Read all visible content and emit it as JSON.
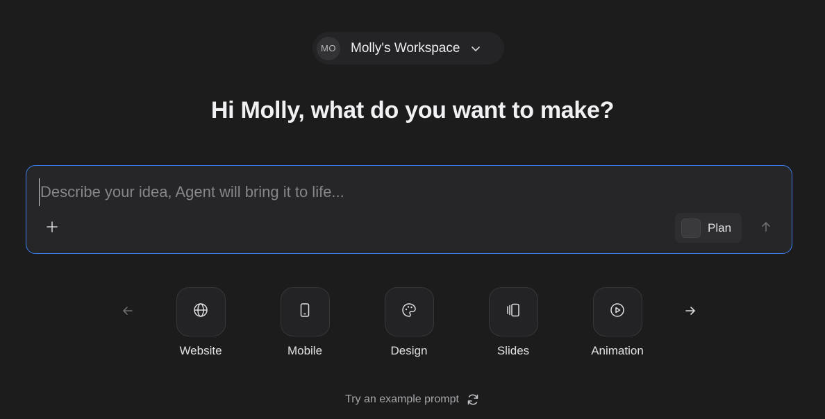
{
  "workspace": {
    "avatar_initials": "MO",
    "name": "Molly's Workspace",
    "chevron_icon": "chevron-down-icon"
  },
  "greeting": "Hi Molly, what do you want to make?",
  "prompt": {
    "placeholder": "Describe your idea, Agent will bring it to life...",
    "value": "",
    "add_icon": "plus-icon",
    "plan_label": "Plan",
    "plan_checked": false,
    "send_icon": "arrow-up-icon"
  },
  "categories": [
    {
      "label": "Website",
      "icon": "globe-icon"
    },
    {
      "label": "Mobile",
      "icon": "phone-icon"
    },
    {
      "label": "Design",
      "icon": "palette-icon"
    },
    {
      "label": "Slides",
      "icon": "slides-icon"
    },
    {
      "label": "Animation",
      "icon": "play-circle-icon"
    }
  ],
  "carousel": {
    "prev_icon": "arrow-left-icon",
    "next_icon": "arrow-right-icon"
  },
  "example": {
    "label": "Try an example prompt",
    "icon": "refresh-icon"
  },
  "colors": {
    "background": "#1c1c1d",
    "accent_border": "#3b7ff0",
    "surface": "#262628"
  }
}
